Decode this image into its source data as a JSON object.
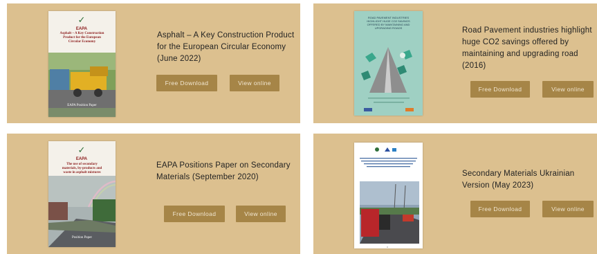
{
  "cards": [
    {
      "title": "Asphalt – A Key Construction Product for the European Circular Economy (June 2022)",
      "download_label": "Free Download",
      "view_label": "View online",
      "cover": {
        "logo": "EAPA",
        "heading": "Asphalt – A Key Construction Product for the European Circular Economy",
        "footer": "EAPA Position Paper"
      }
    },
    {
      "title": "Road Pavement industries highlight huge CO2 savings offered by maintaining and upgrading road (2016)",
      "download_label": "Free Download",
      "view_label": "View online",
      "cover": {
        "heading": "ROAD PAVEMENT INDUSTRIES HIGHLIGHT HUGE CO2 SAVINGS OFFERED BY MAINTAINING AND UPGRADING ROADS"
      }
    },
    {
      "title": "EAPA Positions Paper on Secondary Materials (September 2020)",
      "download_label": "Free Download",
      "view_label": "View online",
      "cover": {
        "logo": "EAPA",
        "heading": "The use of secondary materials, by-products and waste in asphalt mixtures",
        "footer": "Position Paper"
      }
    },
    {
      "title": "Secondary Materials Ukrainian Version (May 2023)",
      "download_label": "Free Download",
      "view_label": "View online",
      "cover": {}
    }
  ],
  "colors": {
    "card_bg": "#dcc08f",
    "button_bg": "#a68547",
    "button_text": "#f2e7d2",
    "eapa_maroon": "#8c1d1d",
    "co2_cover_bg": "#9fd0c3"
  }
}
